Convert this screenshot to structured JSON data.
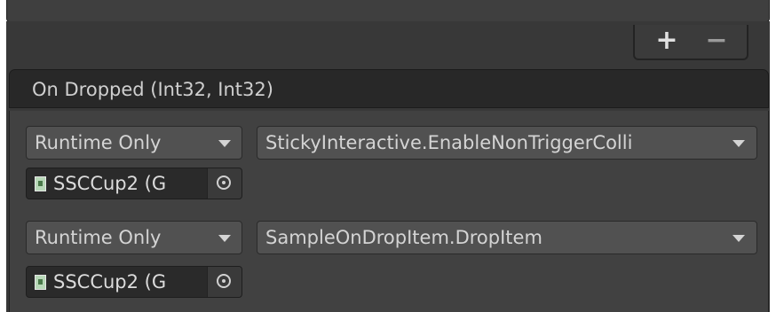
{
  "event": {
    "title": "On Dropped (Int32, Int32)"
  },
  "footer": {
    "add_label": "+",
    "remove_label": "−"
  },
  "listeners": [
    {
      "call_state": "Runtime Only",
      "function": "StickyInteractive.EnableNonTriggerColli",
      "target": "SSCCup2 (G"
    },
    {
      "call_state": "Runtime Only",
      "function": "SampleOnDropItem.DropItem",
      "target": "SSCCup2 (G"
    }
  ],
  "icons": {
    "object_icon": "gameobject-icon",
    "picker_icon": "object-picker-icon",
    "dropdown_icon": "chevron-down-icon"
  }
}
